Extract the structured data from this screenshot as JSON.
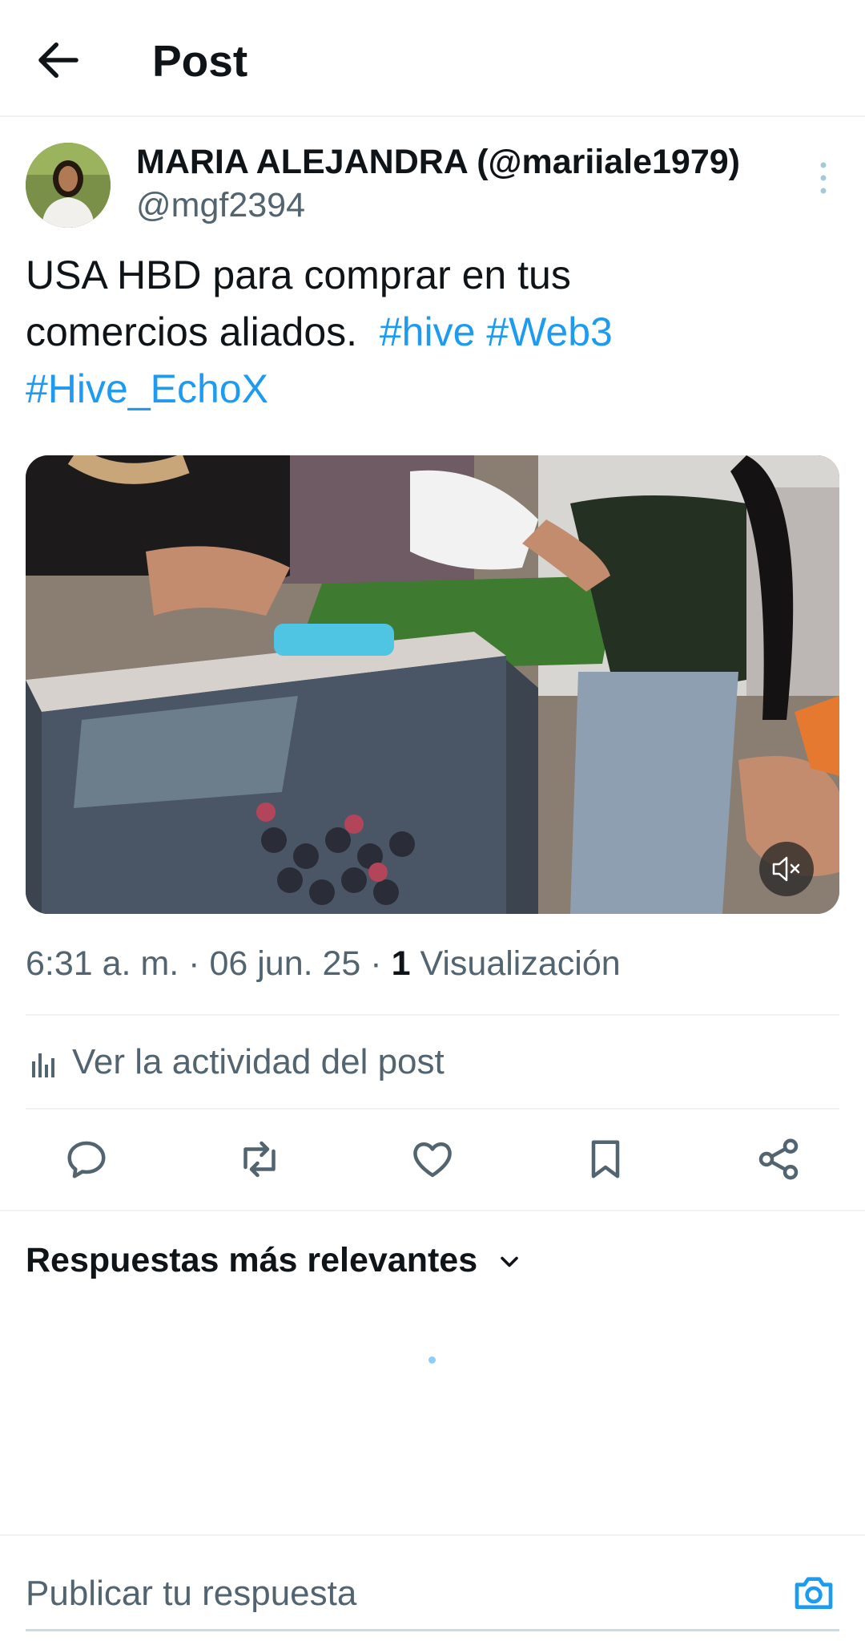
{
  "header": {
    "title": "Post",
    "back_icon": "arrow-left-icon"
  },
  "post": {
    "author": {
      "display_name": "MARIA ALEJANDRA (@mariiale1979)",
      "handle": "@mgf2394"
    },
    "text": {
      "line1": "USA HBD para comprar en tus",
      "line2": "comercios aliados.",
      "hashtags": [
        "#hive",
        "#Web3",
        "#Hive_EchoX"
      ]
    },
    "media": {
      "mute_icon": "volume-mute-icon"
    },
    "meta": {
      "time": "6:31 a. m.",
      "separator": "·",
      "date": "06 jun. 25",
      "views_count": "1",
      "views_label": "Visualización"
    },
    "activity_label": "Ver la actividad del post",
    "actions": [
      {
        "name": "reply",
        "icon": "reply-icon"
      },
      {
        "name": "repost",
        "icon": "repost-icon"
      },
      {
        "name": "like",
        "icon": "heart-icon"
      },
      {
        "name": "bookmark",
        "icon": "bookmark-icon"
      },
      {
        "name": "share",
        "icon": "share-icon"
      }
    ]
  },
  "replies": {
    "sort_label": "Respuestas más relevantes"
  },
  "reply_bar": {
    "placeholder": "Publicar tu respuesta",
    "camera_icon": "camera-icon"
  },
  "colors": {
    "accent": "#1d9bf0",
    "text": "#0f1419",
    "secondary": "#536471",
    "divider": "#eff3f4"
  }
}
